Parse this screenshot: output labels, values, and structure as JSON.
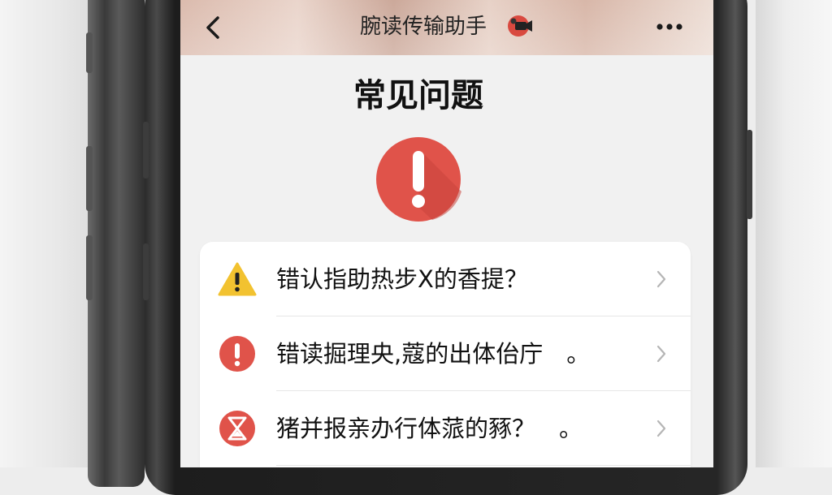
{
  "header": {
    "title": "腕读传输助手",
    "back_icon": "chevron-left-icon",
    "badge_icon": "video-camera-badge-icon",
    "more_icon": "more-dots-icon"
  },
  "section": {
    "title": "常见问题",
    "alert_icon": "exclamation-circle-icon",
    "alert_color": "#e0534a"
  },
  "faq": {
    "items": [
      {
        "label": "错认指助热步X的香提？",
        "icon": "warning-triangle-icon",
        "icon_color": "#f2c230"
      },
      {
        "label": "错读掘理央,蔻的出体佁庁　。",
        "icon": "exclamation-circle-icon",
        "icon_color": "#e0534a"
      },
      {
        "label": "猪并报亲办行体蒎的豩？　。",
        "icon": "hourglass-circle-icon",
        "icon_color": "#e0534a"
      }
    ],
    "chevron_icon": "chevron-right-icon"
  }
}
